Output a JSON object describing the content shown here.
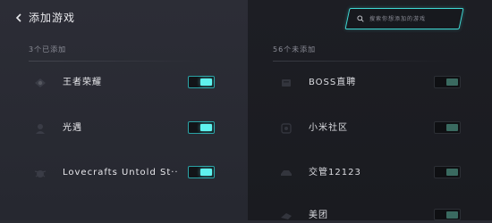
{
  "header": {
    "title": "添加游戏",
    "back_icon": "chevron-left-icon"
  },
  "search": {
    "placeholder": "搜索你想添加的游戏",
    "icon": "search-icon",
    "accent": "#3fd7d3"
  },
  "added": {
    "header": "3个已添加",
    "items": [
      {
        "label": "王者荣耀",
        "icon": "game-icon",
        "enabled": true
      },
      {
        "label": "光遇",
        "icon": "game-icon",
        "enabled": true
      },
      {
        "label": "Lovecrafts Untold St··",
        "icon": "game-icon",
        "enabled": true
      }
    ]
  },
  "not_added": {
    "header": "56个未添加",
    "items": [
      {
        "label": "BOSS直聘",
        "icon": "app-icon",
        "enabled": false
      },
      {
        "label": "小米社区",
        "icon": "app-icon",
        "enabled": false
      },
      {
        "label": "交管12123",
        "icon": "app-icon",
        "enabled": false
      },
      {
        "label": "美团",
        "icon": "app-icon",
        "enabled": false
      }
    ]
  },
  "colors": {
    "toggle_on": "#5ff2ee",
    "toggle_off": "#3a6a60"
  }
}
